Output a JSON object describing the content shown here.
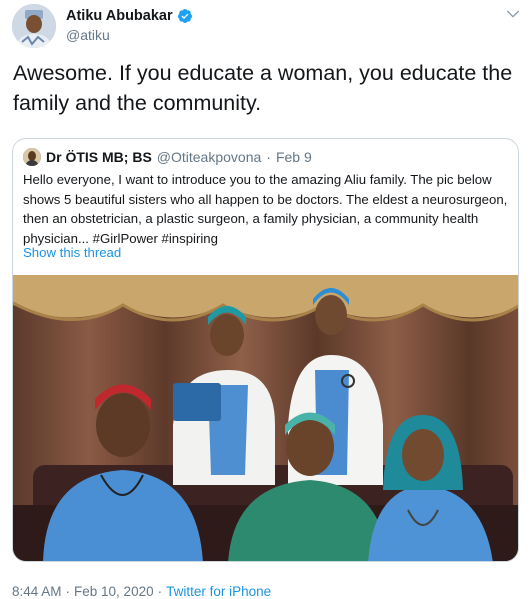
{
  "author": {
    "name": "Atiku Abubakar",
    "handle": "@atiku",
    "verified_color": "#1da1f2"
  },
  "tweet": {
    "text": "Awesome. If you educate a woman, you educate the family and the community."
  },
  "quoted": {
    "name": "Dr ÖTIS MB; BS",
    "handle": "@Otiteakpovona",
    "separator": "·",
    "date": "Feb 9",
    "text": "Hello everyone, I want to introduce you to the amazing Aliu family. The pic below shows 5 beautiful sisters who all happen to be doctors. The eldest a neurosurgeon, then an obstetrician, a plastic surgeon, a family physician, a community health physician... #GirlPower #inspiring",
    "show_thread": "Show this thread"
  },
  "footer": {
    "time": "8:44 AM",
    "separator": "·",
    "date": "Feb 10, 2020",
    "separator2": "·",
    "source": "Twitter for iPhone"
  },
  "colors": {
    "link": "#1b95e0",
    "secondary_text": "#657786",
    "border": "#ccd6dd"
  },
  "icons": [
    "verified-badge-icon",
    "chevron-down-icon"
  ]
}
